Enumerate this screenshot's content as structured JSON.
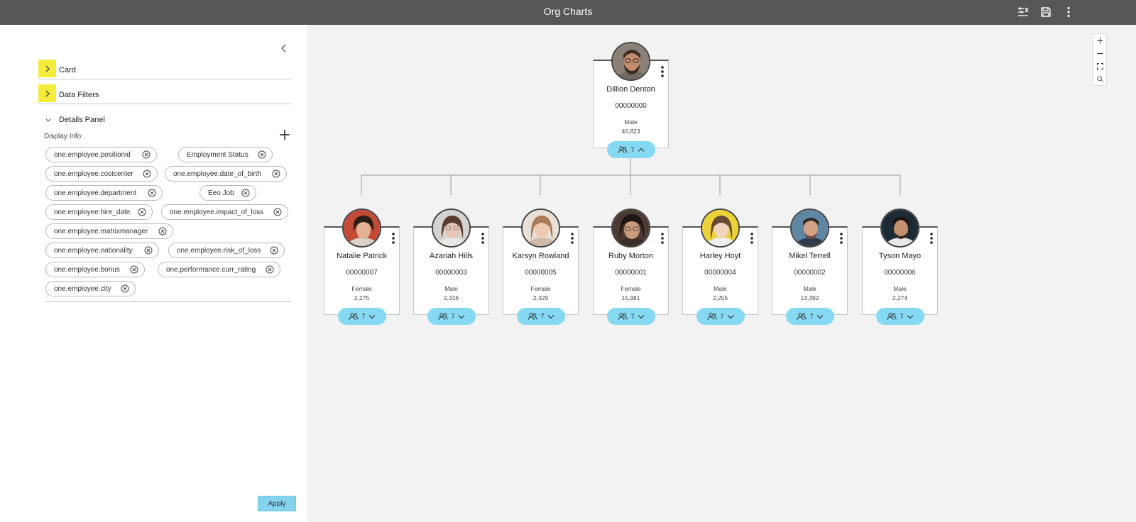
{
  "header": {
    "title": "Org Charts",
    "icons": [
      "filter-settings-icon",
      "save-icon",
      "more-vert-icon"
    ]
  },
  "left_panel": {
    "sections": [
      {
        "label": "Card",
        "expanded": false
      },
      {
        "label": "Data Filters",
        "expanded": false
      }
    ],
    "details_panel": {
      "label": "Details Panel",
      "expanded": true,
      "display_info_label": "Display Info:",
      "chips": [
        "one.employee.positionid",
        "Employment Status",
        "one.employee.costcenter",
        "one.employee.date_of_birth",
        "one.employee.department",
        "Eeo Job",
        "one.employee.hire_date",
        "one.employee.impact_of_loss",
        "one.employee.matrixmanager",
        "one.employee.nationality",
        "one.employee.risk_of_loss",
        "one.employee.bonus",
        "one.performance.curr_rating",
        "one.employee.city"
      ]
    },
    "apply_label": "Apply"
  },
  "org": {
    "root": {
      "name": "Dillion Denton",
      "id": "00000000",
      "gender": "Male",
      "count": "40,823",
      "reports": "7",
      "expanded": true
    },
    "children": [
      {
        "name": "Natalie Patrick",
        "id": "00000007",
        "gender": "Female",
        "count": "2,275",
        "reports": "7"
      },
      {
        "name": "Azariah Hills",
        "id": "00000003",
        "gender": "Male",
        "count": "2,316",
        "reports": "7"
      },
      {
        "name": "Karsyn Rowland",
        "id": "00000005",
        "gender": "Female",
        "count": "2,329",
        "reports": "7"
      },
      {
        "name": "Ruby Morton",
        "id": "00000001",
        "gender": "Female",
        "count": "15,981",
        "reports": "7"
      },
      {
        "name": "Harley Hoyt",
        "id": "00000004",
        "gender": "Male",
        "count": "2,255",
        "reports": "7"
      },
      {
        "name": "Mikel Terrell",
        "id": "00000002",
        "gender": "Male",
        "count": "13,392",
        "reports": "7"
      },
      {
        "name": "Tyson Mayo",
        "id": "00000006",
        "gender": "Male",
        "count": "2,274",
        "reports": "7"
      }
    ]
  },
  "colors": {
    "topbar": "#575757",
    "accent_pill": "#86d9f3",
    "section_highlight": "#f5ec3a",
    "canvas_bg": "#f2f2f2"
  }
}
